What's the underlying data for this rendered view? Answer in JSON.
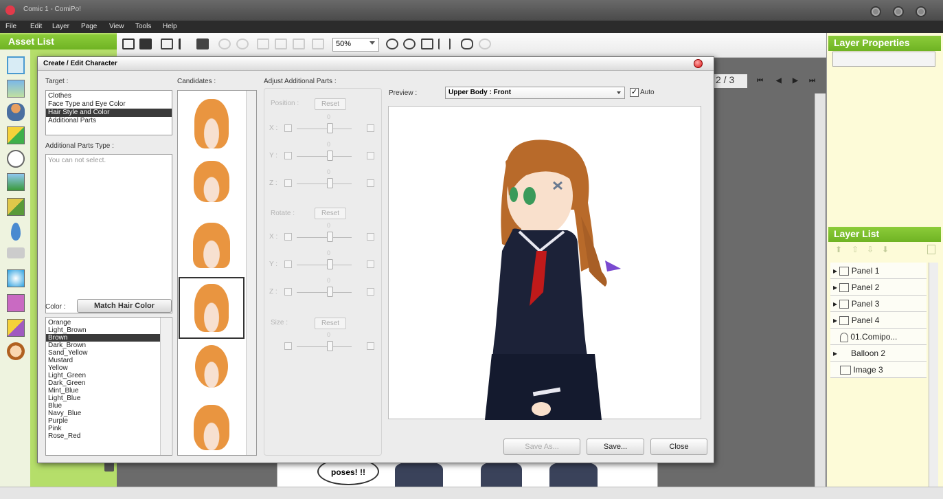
{
  "app": {
    "title": "Comic 1 - ComiPo!"
  },
  "menu": [
    "File",
    "Edit",
    "Layer",
    "Page",
    "View",
    "Tools",
    "Help"
  ],
  "asset_list": {
    "title": "Asset List"
  },
  "toolbar": {
    "zoom": "50%"
  },
  "page_nav": {
    "counter": "2 / 3",
    "first": "⏮",
    "prev": "◀",
    "next": "▶",
    "last": "⏭"
  },
  "layer_properties": {
    "title": "Layer Properties"
  },
  "layer_list": {
    "title": "Layer List",
    "tools": [
      "⬆",
      "⇧",
      "⇩",
      "⬇"
    ],
    "items": [
      "Panel 1",
      "Panel 2",
      "Panel 3",
      "Panel 4",
      "01.Comipo...",
      "Balloon 2",
      "Image 3"
    ]
  },
  "canvas": {
    "balloon_text": "poses! !!"
  },
  "dialog": {
    "title": "Create / Edit Character",
    "target_label": "Target :",
    "target_items": [
      "Clothes",
      "Face Type and Eye Color",
      "Hair Style and Color",
      "Additional Parts"
    ],
    "additional_parts_type_label": "Additional Parts Type :",
    "additional_parts_placeholder": "You can not select.",
    "color_label": "Color :",
    "match_hair_color": "Match Hair Color",
    "colors": [
      "Orange",
      "Light_Brown",
      "Brown",
      "Dark_Brown",
      "Sand_Yellow",
      "Mustard",
      "Yellow",
      "Light_Green",
      "Dark_Green",
      "Mint_Blue",
      "Light_Blue",
      "Blue",
      "Navy_Blue",
      "Purple",
      "Pink",
      "Rose_Red"
    ],
    "candidates_label": "Candidates :",
    "adjust_label": "Adjust Additional Parts :",
    "position_label": "Position :",
    "rotate_label": "Rotate :",
    "size_label": "Size :",
    "reset_label": "Reset",
    "axes": [
      "X :",
      "Y :",
      "Z :"
    ],
    "slider_value": "0",
    "preview_label": "Preview :",
    "preview_view": "Upper Body : Front",
    "auto_label": "Auto",
    "save_as": "Save As...",
    "save": "Save...",
    "close": "Close"
  },
  "colors": {
    "accent_green": "#7bbf2e",
    "selection": "#3a3a3a",
    "hair": "#e99540",
    "uniform": "#1c2238"
  }
}
